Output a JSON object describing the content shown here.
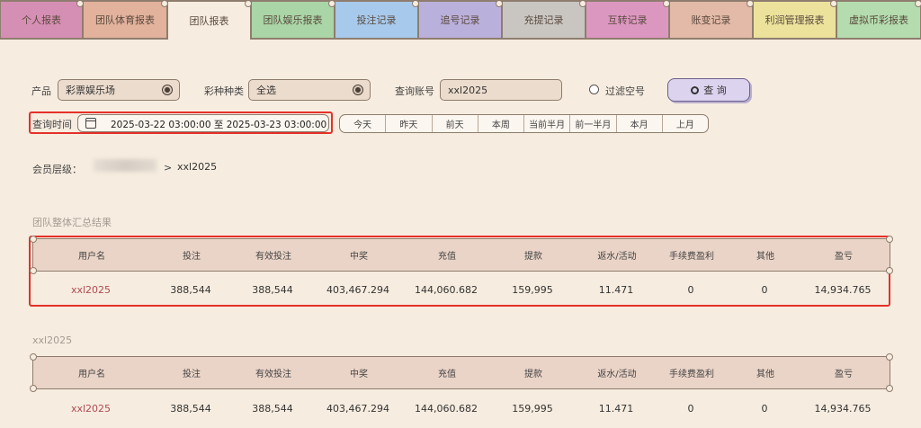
{
  "tabs": [
    {
      "label": "个人报表",
      "color": "#d68fb4"
    },
    {
      "label": "团队体育报表",
      "color": "#e2b29c"
    },
    {
      "label": "团队报表",
      "color": "#f6ecdf",
      "active": true
    },
    {
      "label": "团队娱乐报表",
      "color": "#aad5a6"
    },
    {
      "label": "投注记录",
      "color": "#a7c9ec"
    },
    {
      "label": "追号记录",
      "color": "#bab0dc"
    },
    {
      "label": "充提记录",
      "color": "#c9c6c2"
    },
    {
      "label": "互转记录",
      "color": "#dc97c0"
    },
    {
      "label": "账变记录",
      "color": "#e3b9a7"
    },
    {
      "label": "利润管理报表",
      "color": "#ece29c"
    },
    {
      "label": "虚拟币彩报表",
      "color": "#b4dcae"
    }
  ],
  "filters": {
    "product_label": "产品",
    "product_value": "彩票娱乐场",
    "lottery_type_label": "彩种种类",
    "lottery_type_value": "全选",
    "account_label": "查询账号",
    "account_value": "xxl2025",
    "filter_empty_label": "过滤空号",
    "query_button": "查 询",
    "time_label": "查询时间",
    "time_value": "2025-03-22 03:00:00 至 2025-03-23 03:00:00"
  },
  "quick_ranges": [
    "今天",
    "昨天",
    "前天",
    "本周",
    "当前半月",
    "前一半月",
    "本月",
    "上月"
  ],
  "member_level": {
    "label": "会员层级：",
    "arrow": ">",
    "value": "xxl2025"
  },
  "summary": {
    "title": "团队整体汇总结果",
    "columns": [
      "用户名",
      "投注",
      "有效投注",
      "中奖",
      "充值",
      "提款",
      "返水/活动",
      "手续费盈利",
      "其他",
      "盈亏"
    ],
    "row": [
      "xxl2025",
      "388,544",
      "388,544",
      "403,467.294",
      "144,060.682",
      "159,995",
      "11.471",
      "0",
      "0",
      "14,934.765"
    ]
  },
  "detail": {
    "title": "xxl2025",
    "columns": [
      "用户名",
      "投注",
      "有效投注",
      "中奖",
      "充值",
      "提款",
      "返水/活动",
      "手续费盈利",
      "其他",
      "盈亏"
    ],
    "row": [
      "xxl2025",
      "388,544",
      "388,544",
      "403,467.294",
      "144,060.682",
      "159,995",
      "11.471",
      "0",
      "0",
      "14,934.765"
    ]
  },
  "colors": {
    "highlight": "#e5302a",
    "username": "#b04a55",
    "background": "#f6ecdf",
    "table_header": "#ead4c7"
  }
}
